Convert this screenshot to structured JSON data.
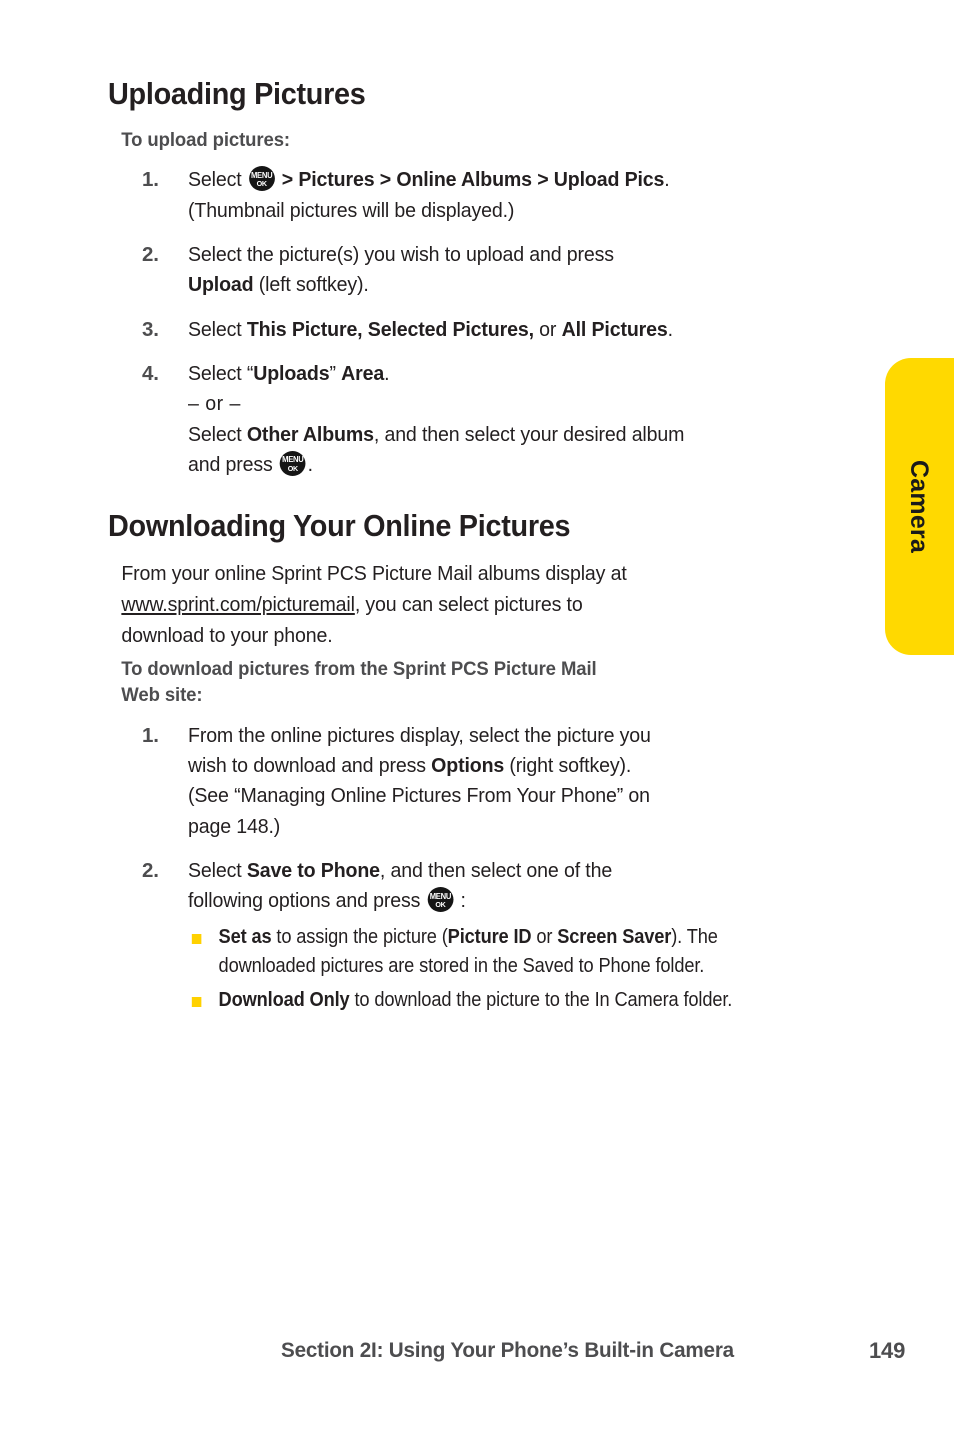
{
  "page": {
    "background_color": "#ffffff",
    "text_color": "#231f20",
    "accent_color": "#ffd900"
  },
  "side_tab": {
    "label": "Camera",
    "color": "#ffd900"
  },
  "sections": [
    {
      "heading": "Uploading Pictures",
      "sub_heading": "To upload pictures:"
    },
    {
      "heading": "Downloading Your Online Pictures",
      "sub_heading_line1": "To download pictures from the Sprint PCS Picture Mail",
      "sub_heading_line2": "Web site:"
    }
  ],
  "upload_steps": [
    {
      "number": "1.",
      "line1_a": "Select ",
      "line1_icon": "menu-ok-key-icon",
      "line1_b": " > ",
      "line1_bold1": "Pictures",
      "line1_c": " > ",
      "line1_bold2": "Online Albums",
      "line1_d": " > ",
      "line1_bold3": "Upload Pics",
      "line1_e": ".",
      "line2": "(Thumbnail pictures will be displayed.)"
    },
    {
      "number": "2.",
      "line1": "Select the picture(s) you wish to upload and press",
      "line2_bold": "Upload",
      "line2_rest": " (left softkey)."
    },
    {
      "number": "3.",
      "line1_a": "Select ",
      "line1_bold1": "This Picture, Selected Pictures,",
      "line1_b": " or ",
      "line1_bold2": "All Pictures",
      "line1_c": "."
    },
    {
      "number": "4.",
      "line1_a": "Select “",
      "line1_bold1": "Uploads",
      "line1_b": "” ",
      "line1_bold2": "Area",
      "line1_c": ".",
      "or_line": "– or –",
      "line3_a": "Select ",
      "line3_bold": "Other Albums",
      "line3_b": ", and then select your desired album",
      "line4_a": "and press ",
      "line4_icon": "menu-ok-key-icon",
      "line4_b": "."
    }
  ],
  "download_intro": {
    "line1": "From your online Sprint PCS Picture Mail albums display at",
    "url": "www.sprint.com/picturemail",
    "line2_rest": ", you can select pictures to",
    "line3": "download to your phone."
  },
  "download_steps": [
    {
      "number": "1.",
      "line1": "From the online pictures display, select the picture you",
      "line2_a": "wish to download and press ",
      "line2_bold": "Options",
      "line2_b": " (right softkey).",
      "line3": "(See “Managing Online Pictures From Your Phone” on",
      "line4": "page 148.)"
    },
    {
      "number": "2.",
      "line1_a": "Select ",
      "line1_bold": "Save to Phone",
      "line1_b": ", and then select one of the",
      "line2_a": "following options and press ",
      "line2_icon": "menu-ok-key-icon",
      "line2_b": " :",
      "bullets": [
        {
          "bold1": "Set as",
          "text1": " to assign the picture (",
          "bold2": "Picture ID",
          "text2": " or ",
          "bold3": "Screen Saver",
          "text3": "). The downloaded pictures are stored in the Saved to Phone folder."
        },
        {
          "bold1": "Download Only",
          "text1": " to download the picture to the In Camera folder."
        }
      ]
    }
  ],
  "footer": {
    "title": "Section 2I: Using Your Phone’s Built-in Camera",
    "page_number": "149"
  },
  "icons": {
    "menu_ok_key": {
      "top_label": "MENU",
      "bottom_label": "OK"
    }
  }
}
